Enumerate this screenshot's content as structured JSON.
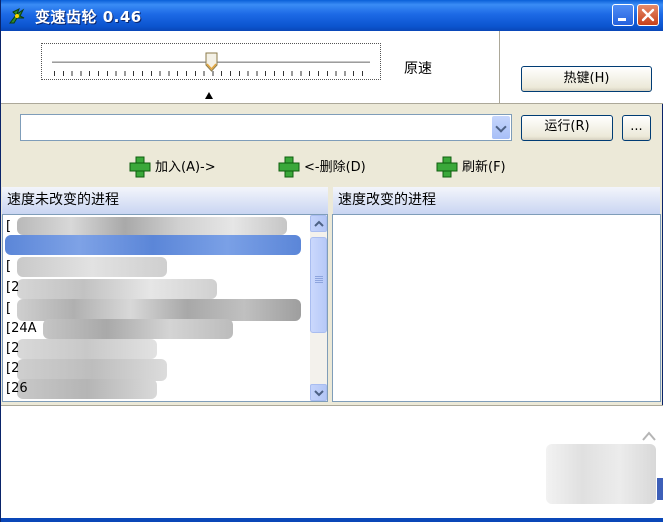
{
  "window": {
    "title": "变速齿轮 0.46"
  },
  "speed": {
    "label": "原速",
    "slider_position_fraction": 0.5
  },
  "buttons": {
    "hotkey": "热键(H)",
    "run": "运行(R)",
    "more": "..."
  },
  "process_combo": {
    "value": ""
  },
  "actions": {
    "add": "加入(A)->",
    "remove": "<-删除(D)",
    "refresh": "刷新(F)"
  },
  "lists": {
    "left_header": "速度未改变的进程",
    "right_header": "速度改变的进程",
    "left_rows": [
      "[",
      "",
      "[",
      "[2",
      "[",
      "[24A",
      "[2",
      "[2",
      "[26"
    ]
  },
  "colors": {
    "title_blue": "#1d6ae6",
    "selection_blue": "#316ac5",
    "action_icon_green": "#3aa83a"
  }
}
